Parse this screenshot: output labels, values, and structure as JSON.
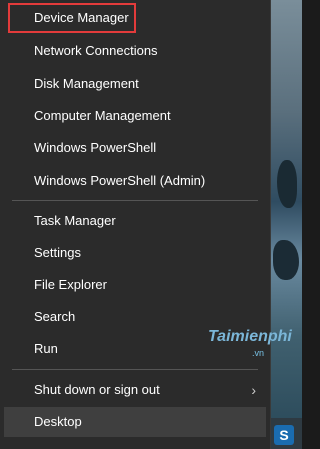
{
  "menu": {
    "groups": [
      {
        "items": [
          {
            "label": "Device Manager"
          },
          {
            "label": "Network Connections"
          },
          {
            "label": "Disk Management"
          },
          {
            "label": "Computer Management"
          },
          {
            "label": "Windows PowerShell"
          },
          {
            "label": "Windows PowerShell (Admin)"
          }
        ]
      },
      {
        "items": [
          {
            "label": "Task Manager"
          },
          {
            "label": "Settings"
          },
          {
            "label": "File Explorer"
          },
          {
            "label": "Search"
          },
          {
            "label": "Run"
          }
        ]
      },
      {
        "items": [
          {
            "label": "Shut down or sign out"
          },
          {
            "label": "Desktop"
          }
        ]
      }
    ],
    "chevron": "›"
  },
  "watermark": {
    "text": "Taimienphi",
    "suffix": ".vn",
    "logo": "S"
  },
  "colors": {
    "menu_bg": "#2b2b2b",
    "highlight_border": "#e23b3b",
    "hover_bg": "#3f3f3f"
  }
}
